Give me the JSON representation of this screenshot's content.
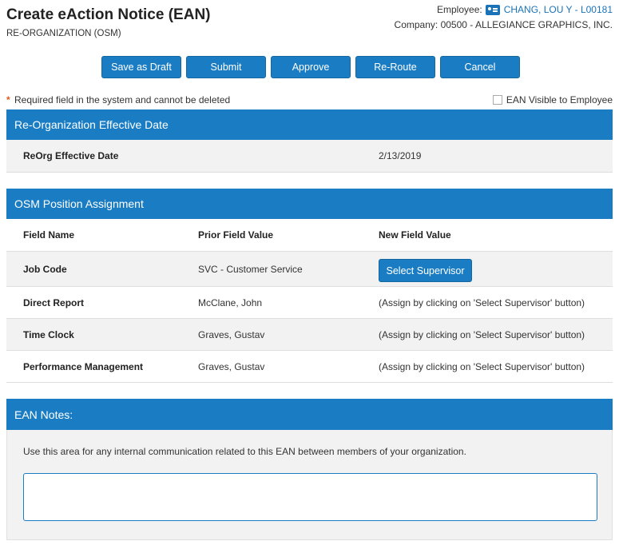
{
  "header": {
    "title": "Create eAction Notice (EAN)",
    "subtitle": "RE-ORGANIZATION (OSM)",
    "employee_label": "Employee:",
    "employee_value": "CHANG, LOU Y - L00181",
    "company_text": "Company: 00500 - ALLEGIANCE GRAPHICS, INC."
  },
  "actions": {
    "save_draft": "Save as Draft",
    "submit": "Submit",
    "approve": "Approve",
    "reroute": "Re-Route",
    "cancel": "Cancel"
  },
  "required_note": {
    "star": "*",
    "text": "Required field in the system and cannot be deleted"
  },
  "visible_checkbox": {
    "label": "EAN Visible to Employee",
    "checked": false
  },
  "effective_date_section": {
    "title": "Re-Organization Effective Date",
    "label": "ReOrg Effective Date",
    "value": "2/13/2019"
  },
  "osm_section": {
    "title": "OSM Position Assignment",
    "headers": {
      "field": "Field Name",
      "prior": "Prior Field Value",
      "new": "New Field Value"
    },
    "select_button": "Select Supervisor",
    "rows": [
      {
        "field": "Job Code",
        "prior": "SVC - Customer Service",
        "new": ""
      },
      {
        "field": "Direct Report",
        "prior": "McClane, John",
        "new": "(Assign by clicking on 'Select Supervisor' button)"
      },
      {
        "field": "Time Clock",
        "prior": "Graves, Gustav",
        "new": "(Assign by clicking on 'Select Supervisor' button)"
      },
      {
        "field": "Performance Management",
        "prior": "Graves, Gustav",
        "new": "(Assign by clicking on 'Select Supervisor' button)"
      }
    ]
  },
  "notes_section": {
    "title": "EAN Notes:",
    "description": "Use this area for any internal communication related to this EAN between members of your organization.",
    "value": ""
  },
  "colors": {
    "accent": "#1a7dc4",
    "link": "#1a73b8",
    "required_star": "#e05a1a"
  }
}
